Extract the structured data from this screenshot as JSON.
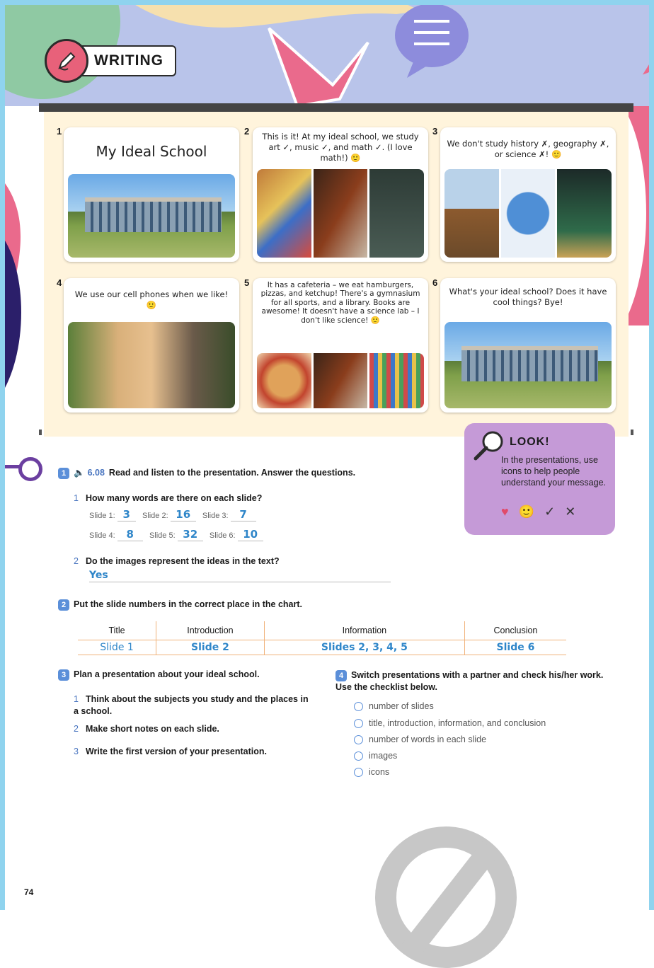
{
  "header": {
    "title": "WRITING"
  },
  "slides": [
    {
      "num": "1",
      "title": "My Ideal School"
    },
    {
      "num": "2",
      "text": "This is it! At my ideal school, we study art ✓, music ✓, and math ✓. (I love math!) 🙂"
    },
    {
      "num": "3",
      "text": "We don't study history ✗, geography ✗, or science ✗! 🙂"
    },
    {
      "num": "4",
      "text": "We use our cell phones when we like! 🙂"
    },
    {
      "num": "5",
      "text": "It has a cafeteria – we eat hamburgers, pizzas, and ketchup! There's a gymnasium for all sports, and a library. Books are awesome! It doesn't have a science lab – I don't like science! 🙂"
    },
    {
      "num": "6",
      "text": "What's your ideal school? Does it have cool things? Bye!"
    }
  ],
  "look": {
    "title": "LOOK!",
    "text": "In the presentations, use icons to help people understand your message.",
    "icons": [
      "♥",
      "🙂",
      "✓",
      "✕"
    ]
  },
  "ex1": {
    "num": "1",
    "audio": "6.08",
    "instruction": "Read and listen to the presentation. Answer the questions.",
    "q1": {
      "n": "1",
      "text": "How many words are there on each slide?"
    },
    "slide_labels": [
      "Slide 1:",
      "Slide 2:",
      "Slide 3:",
      "Slide 4:",
      "Slide 5:",
      "Slide 6:"
    ],
    "slide_answers": [
      "3",
      "16",
      "7",
      "8",
      "32",
      "10"
    ],
    "q2": {
      "n": "2",
      "text": "Do the images represent the ideas in the text?",
      "answer": "Yes"
    }
  },
  "ex2": {
    "num": "2",
    "instruction": "Put the slide numbers in the correct place in the chart.",
    "headers": [
      "Title",
      "Introduction",
      "Information",
      "Conclusion"
    ],
    "row": [
      "Slide 1",
      "Slide 2",
      "Slides 2, 3, 4, 5",
      "Slide 6"
    ]
  },
  "ex3": {
    "num": "3",
    "instruction": "Plan a presentation about your ideal school.",
    "items": [
      {
        "n": "1",
        "text": "Think about the subjects you study and the places in a school."
      },
      {
        "n": "2",
        "text": "Make short notes on each slide."
      },
      {
        "n": "3",
        "text": "Write the first version of your presentation."
      }
    ]
  },
  "ex4": {
    "num": "4",
    "instruction": "Switch presentations with a partner and check his/her work. Use the checklist below.",
    "checklist": [
      "number of slides",
      "title, introduction, information, and conclusion",
      "number of words in each slide",
      "images",
      "icons"
    ]
  },
  "page_number": "74",
  "colors": {
    "frame": "#8fd3ee",
    "accent_blue": "#5b8fd9",
    "answer_blue": "#2f86c9",
    "look_bg": "#c59ad7",
    "board_bg": "#fff4dc"
  }
}
